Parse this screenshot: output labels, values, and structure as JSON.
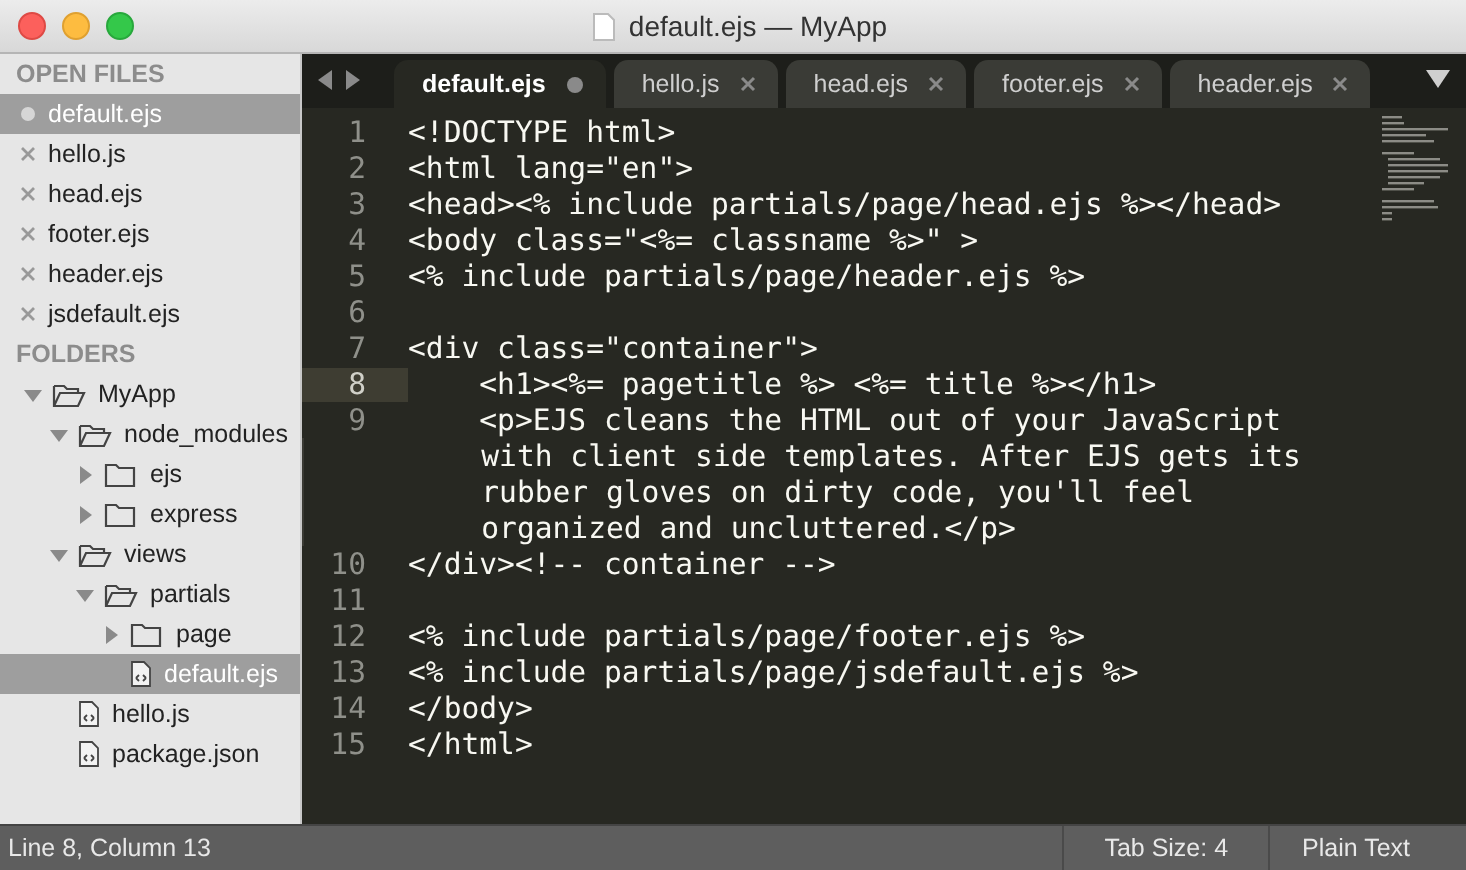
{
  "window": {
    "title": "default.ejs — MyApp"
  },
  "sidebar": {
    "open_files_heading": "OPEN FILES",
    "open_files": [
      {
        "name": "default.ejs",
        "selected": true,
        "modified": true
      },
      {
        "name": "hello.js",
        "selected": false,
        "modified": false
      },
      {
        "name": "head.ejs",
        "selected": false,
        "modified": false
      },
      {
        "name": "footer.ejs",
        "selected": false,
        "modified": false
      },
      {
        "name": "header.ejs",
        "selected": false,
        "modified": false
      },
      {
        "name": "jsdefault.ejs",
        "selected": false,
        "modified": false
      }
    ],
    "folders_heading": "FOLDERS",
    "tree": [
      {
        "name": "MyApp",
        "kind": "folder",
        "expanded": true,
        "selected": false,
        "children": [
          {
            "name": "node_modules",
            "kind": "folder",
            "expanded": true,
            "selected": false,
            "children": [
              {
                "name": "ejs",
                "kind": "folder",
                "expanded": false,
                "selected": false
              },
              {
                "name": "express",
                "kind": "folder",
                "expanded": false,
                "selected": false
              }
            ]
          },
          {
            "name": "views",
            "kind": "folder",
            "expanded": true,
            "selected": false,
            "children": [
              {
                "name": "partials",
                "kind": "folder",
                "expanded": true,
                "selected": false,
                "children": [
                  {
                    "name": "page",
                    "kind": "folder",
                    "expanded": false,
                    "selected": false
                  },
                  {
                    "name": "default.ejs",
                    "kind": "file",
                    "selected": true
                  }
                ]
              }
            ]
          },
          {
            "name": "hello.js",
            "kind": "file",
            "selected": false
          },
          {
            "name": "package.json",
            "kind": "file",
            "selected": false
          }
        ]
      }
    ]
  },
  "tabs": [
    {
      "label": "default.ejs",
      "selected": true,
      "modified": true
    },
    {
      "label": "hello.js",
      "selected": false,
      "modified": false
    },
    {
      "label": "head.ejs",
      "selected": false,
      "modified": false
    },
    {
      "label": "footer.ejs",
      "selected": false,
      "modified": false
    },
    {
      "label": "header.ejs",
      "selected": false,
      "modified": false
    }
  ],
  "editor": {
    "lines": [
      {
        "number": "1",
        "current": false,
        "segments": [
          "<!DOCTYPE html>"
        ]
      },
      {
        "number": "2",
        "current": false,
        "segments": [
          "<html lang=\"en\">"
        ]
      },
      {
        "number": "3",
        "current": false,
        "segments": [
          "<head><% include partials/page/head.ejs %></head>"
        ]
      },
      {
        "number": "4",
        "current": false,
        "segments": [
          "<body class=\"<%= classname %>\" >"
        ]
      },
      {
        "number": "5",
        "current": false,
        "segments": [
          "<% include partials/page/header.ejs %>"
        ]
      },
      {
        "number": "6",
        "current": false
      },
      {
        "number": "7",
        "current": false,
        "segments": [
          "<div class=\"container\">"
        ]
      },
      {
        "number": "8",
        "current": true,
        "segments": [
          "    <h1><%= pagetitle %> <%= title %></h1>"
        ]
      },
      {
        "number": "9",
        "current": false,
        "segments": [
          "    <p>EJS cleans the HTML out of your JavaScript",
          "    with client side templates. After EJS gets its",
          "    rubber gloves on dirty code, you'll feel",
          "    organized and uncluttered.</p>"
        ]
      },
      {
        "number": "10",
        "current": false,
        "segments": [
          "</div><!-- container -->"
        ]
      },
      {
        "number": "11",
        "current": false
      },
      {
        "number": "12",
        "current": false,
        "segments": [
          "<% include partials/page/footer.ejs %>"
        ]
      },
      {
        "number": "13",
        "current": false,
        "segments": [
          "<% include partials/page/jsdefault.ejs %>"
        ]
      },
      {
        "number": "14",
        "current": false,
        "segments": [
          "</body>"
        ]
      },
      {
        "number": "15",
        "current": false,
        "segments": [
          "</html>"
        ]
      }
    ]
  },
  "status_bar": {
    "position": "Line 8, Column 13",
    "tab_size": "Tab Size: 4",
    "syntax": "Plain Text"
  }
}
